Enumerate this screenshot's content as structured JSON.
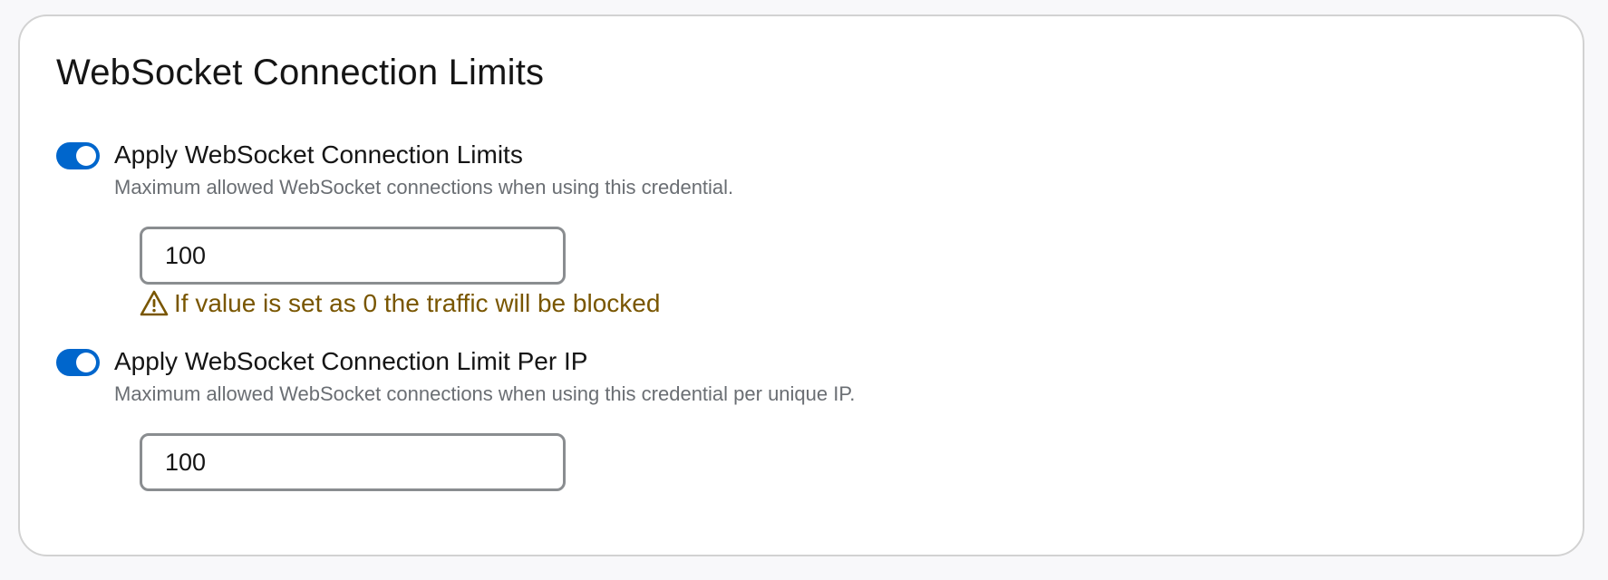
{
  "card": {
    "title": "WebSocket Connection Limits"
  },
  "settings": [
    {
      "label": "Apply WebSocket Connection Limits",
      "description": "Maximum allowed WebSocket connections when using this credential.",
      "enabled": true,
      "value": "100",
      "warning": "If value is set as 0 the traffic will be blocked",
      "warning_icon": "warning-triangle-icon"
    },
    {
      "label": "Apply WebSocket Connection Limit Per IP",
      "description": "Maximum allowed WebSocket connections when using this credential per unique IP.",
      "enabled": true,
      "value": "100"
    }
  ],
  "colors": {
    "toggle_on": "#0066cc",
    "warning_text": "#795600",
    "description_text": "#6a6e73",
    "input_border": "#8a8d90"
  }
}
